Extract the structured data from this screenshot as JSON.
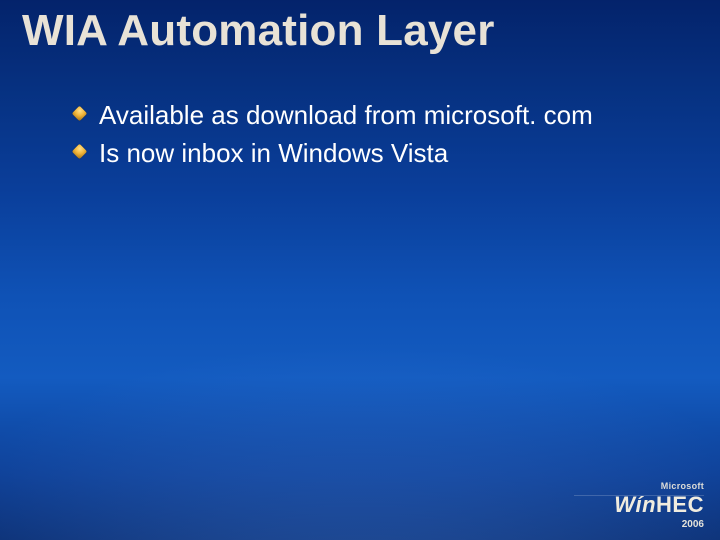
{
  "title": "WIA Automation Layer",
  "bullets": [
    "Available as download from microsoft. com",
    "Is now inbox in Windows Vista"
  ],
  "logo": {
    "top": "Microsoft",
    "brand_prefix": "Wín",
    "brand_suffix": "HEC",
    "year": "2006"
  }
}
